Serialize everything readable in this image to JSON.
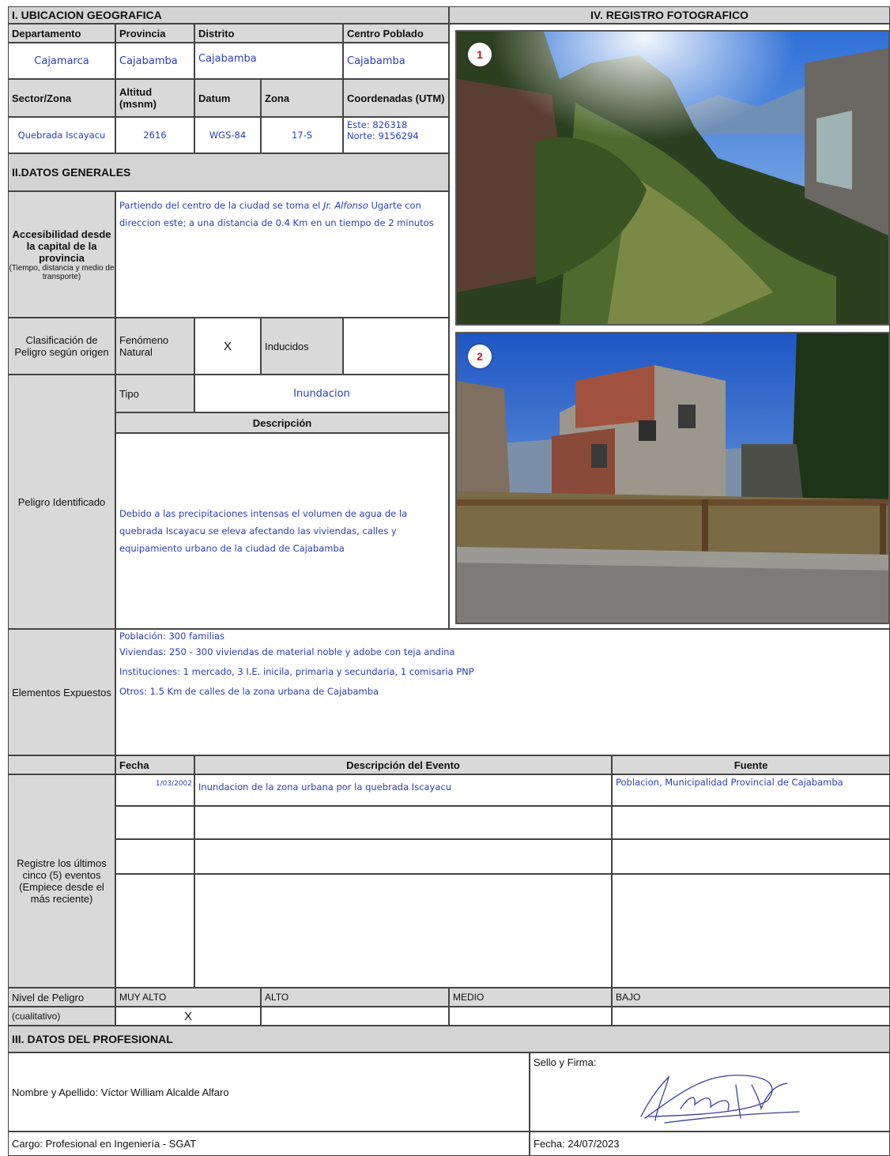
{
  "s1": {
    "title": "I. UBICACION GEOGRAFICA",
    "h_dep": "Departamento",
    "h_prov": "Provincia",
    "h_dist": "Distrito",
    "h_cp": "Centro Poblado",
    "v_dep": "Cajamarca",
    "v_prov": "Cajabamba",
    "v_dist": "Cajabamba",
    "v_cp": "Cajabamba",
    "h_sector": "Sector/Zona",
    "h_alt": "Altitud (msnm)",
    "h_datum": "Datum",
    "h_zona": "Zona",
    "h_coord": "Coordenadas (UTM)",
    "v_sector": "Quebrada Iscayacu",
    "v_alt": "2616",
    "v_datum": "WGS-84",
    "v_zona": "17-S",
    "v_este": "Este: 826318",
    "v_norte": "Norte: 9156294"
  },
  "s2": {
    "title": "II.DATOS GENERALES",
    "acc_label": "Accesibilidad desde la capital de la provincia",
    "acc_sub": "(Tiempo, distancia y medio de transporte)",
    "acc_pre": "Partiendo del centro de la ciudad se toma el ",
    "acc_street": "Jr. Alfonso",
    "acc_post": " Ugarte con direccion este; a una distancia de 0.4 Km en un tiempo de 2 minutos",
    "clas_label": "Clasificación de Peligro según origen",
    "fen_label": "Fenómeno Natural",
    "fen_mark": "X",
    "ind_label": "Inducidos",
    "ind_mark": "",
    "pel_label": "Peligro Identificado",
    "tipo_label": "Tipo",
    "tipo_value": "Inundacion",
    "desc_label": "Descripción",
    "desc_text": "Debido a las precipitaciones intensas el volumen de agua de la quebrada Iscayacu se eleva afectando las viviendas, calles y equipamiento urbano de la ciudad de Cajabamba",
    "elem_label": "Elementos Expuestos",
    "elem_lines": [
      "Población: 300 familias",
      "Viviendas: 250 - 300 viviendas de material noble y adobe con teja andina",
      "Instituciones: 1 mercado, 3 I.E. inicila, primaria y secundaria, 1 comisaria PNP",
      "Otros: 1.5 Km de calles de la zona urbana de Cajabamba"
    ],
    "ev_h_fecha": "Fecha",
    "ev_h_desc": "Descripción del Evento",
    "ev_h_fuente": "Fuente",
    "ev_label": "Registre los últimos cinco (5) eventos (Empiece desde el más reciente)",
    "events": [
      {
        "fecha": "1/03/2002",
        "desc": "Inundacion de la zona urbana por la quebrada Iscayacu",
        "fuente": "Poblacion, Municipalidad Provincial de Cajabamba"
      },
      {
        "fecha": "",
        "desc": "",
        "fuente": ""
      },
      {
        "fecha": "",
        "desc": "",
        "fuente": ""
      },
      {
        "fecha": "",
        "desc": "",
        "fuente": ""
      }
    ],
    "niv_label1": "Nivel de Peligro",
    "niv_label2": "(cualitativo)",
    "niv_muyalto": "MUY ALTO",
    "niv_alto": "ALTO",
    "niv_medio": "MEDIO",
    "niv_bajo": "BAJO",
    "niv_mark": "X"
  },
  "s3": {
    "title": "III. DATOS DEL PROFESIONAL",
    "nombre": "Nombre y Apellido: Víctor William Alcalde Alfaro",
    "sello": "Sello y Firma:",
    "cargo": "Cargo: Profesional en Ingeniería - SGAT",
    "fecha": "Fecha: 24/07/2023"
  },
  "s4": {
    "title": "IV. REGISTRO FOTOGRAFICO",
    "badge1": "1",
    "badge2": "2"
  }
}
